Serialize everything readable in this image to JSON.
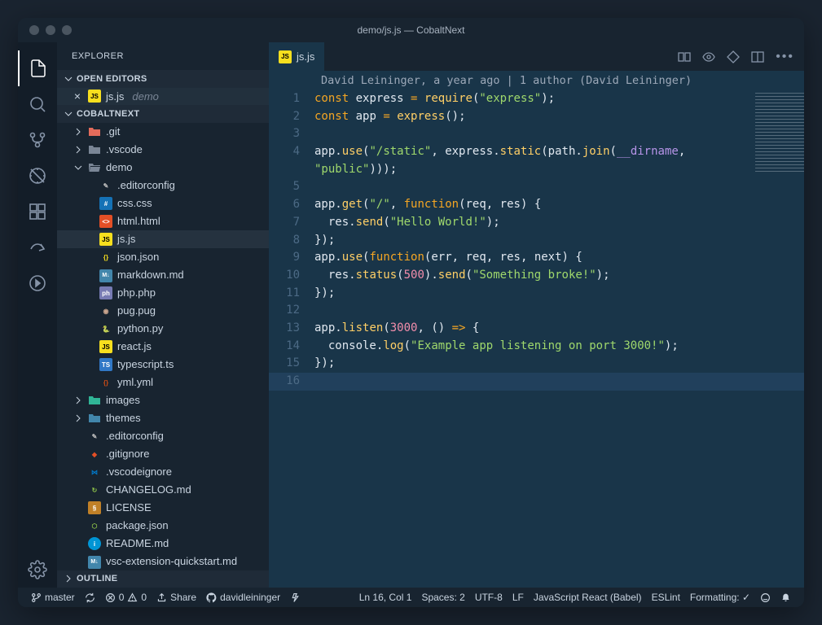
{
  "window": {
    "title": "demo/js.js — CobaltNext"
  },
  "sidebar": {
    "title": "EXPLORER",
    "sections": {
      "open_editors": {
        "label": "OPEN EDITORS",
        "items": [
          {
            "name": "js.js",
            "dir": "demo",
            "icon": "js"
          }
        ]
      },
      "workspace": {
        "label": "COBALTNEXT",
        "tree": [
          {
            "d": 0,
            "chev": "right",
            "icon": "folder-git",
            "name": ".git"
          },
          {
            "d": 0,
            "chev": "right",
            "icon": "folder",
            "name": ".vscode"
          },
          {
            "d": 0,
            "chev": "down",
            "icon": "folder-open",
            "name": "demo"
          },
          {
            "d": 1,
            "icon": "config",
            "name": ".editorconfig"
          },
          {
            "d": 1,
            "icon": "css",
            "name": "css.css"
          },
          {
            "d": 1,
            "icon": "html",
            "name": "html.html"
          },
          {
            "d": 1,
            "icon": "js",
            "name": "js.js",
            "active": true
          },
          {
            "d": 1,
            "icon": "json",
            "name": "json.json"
          },
          {
            "d": 1,
            "icon": "md",
            "name": "markdown.md"
          },
          {
            "d": 1,
            "icon": "php",
            "name": "php.php"
          },
          {
            "d": 1,
            "icon": "pug",
            "name": "pug.pug"
          },
          {
            "d": 1,
            "icon": "py",
            "name": "python.py"
          },
          {
            "d": 1,
            "icon": "js",
            "name": "react.js"
          },
          {
            "d": 1,
            "icon": "ts",
            "name": "typescript.ts"
          },
          {
            "d": 1,
            "icon": "yml",
            "name": "yml.yml"
          },
          {
            "d": 0,
            "chev": "right",
            "icon": "folder-img",
            "name": "images"
          },
          {
            "d": 0,
            "chev": "right",
            "icon": "folder-theme",
            "name": "themes"
          },
          {
            "d": 0,
            "icon": "config",
            "name": ".editorconfig"
          },
          {
            "d": 0,
            "icon": "git",
            "name": ".gitignore"
          },
          {
            "d": 0,
            "icon": "vs",
            "name": ".vscodeignore"
          },
          {
            "d": 0,
            "icon": "changelog",
            "name": "CHANGELOG.md"
          },
          {
            "d": 0,
            "icon": "license",
            "name": "LICENSE"
          },
          {
            "d": 0,
            "icon": "npm",
            "name": "package.json"
          },
          {
            "d": 0,
            "icon": "readme",
            "name": "README.md"
          },
          {
            "d": 0,
            "icon": "md",
            "name": "vsc-extension-quickstart.md"
          }
        ]
      },
      "outline": {
        "label": "OUTLINE"
      }
    }
  },
  "tabs": {
    "open": [
      {
        "name": "js.js",
        "icon": "js"
      }
    ]
  },
  "editor": {
    "blame": "David Leininger, a year ago | 1 author (David Leininger)",
    "code_lines": [
      {
        "n": 1,
        "html": "<span class='kw'>const</span> <span class='id'>express</span> <span class='op'>=</span> <span class='method'>require</span><span class='paren'>(</span><span class='str'>\"express\"</span><span class='paren'>)</span>;"
      },
      {
        "n": 2,
        "html": "<span class='kw'>const</span> <span class='id'>app</span> <span class='op'>=</span> <span class='method'>express</span><span class='paren'>()</span>;"
      },
      {
        "n": 3,
        "html": ""
      },
      {
        "n": 4,
        "html": "<span class='id'>app</span>.<span class='method'>use</span><span class='paren'>(</span><span class='str'>\"/static\"</span>, <span class='id'>express</span>.<span class='method'>static</span><span class='paren'>(</span><span class='id'>path</span>.<span class='method'>join</span><span class='paren'>(</span><span class='global'>__dirname</span>,"
      },
      {
        "n": "",
        "html": "<span class='str'>\"public\"</span><span class='paren'>)))</span>;"
      },
      {
        "n": 5,
        "html": ""
      },
      {
        "n": 6,
        "html": "<span class='id'>app</span>.<span class='method'>get</span><span class='paren'>(</span><span class='str'>\"/\"</span>, <span class='kw'>function</span><span class='paren'>(</span><span class='id'>req</span>, <span class='id'>res</span><span class='paren'>)</span> <span class='paren'>{</span>"
      },
      {
        "n": 7,
        "html": "  <span class='id'>res</span>.<span class='method'>send</span><span class='paren'>(</span><span class='str'>\"Hello World!\"</span><span class='paren'>)</span>;"
      },
      {
        "n": 8,
        "html": "<span class='paren'>})</span>;"
      },
      {
        "n": 9,
        "html": "<span class='id'>app</span>.<span class='method'>use</span><span class='paren'>(</span><span class='kw'>function</span><span class='paren'>(</span><span class='id'>err</span>, <span class='id'>req</span>, <span class='id'>res</span>, <span class='id'>next</span><span class='paren'>)</span> <span class='paren'>{</span>"
      },
      {
        "n": 10,
        "html": "  <span class='id'>res</span>.<span class='method'>status</span><span class='paren'>(</span><span class='num'>500</span><span class='paren'>)</span>.<span class='method'>send</span><span class='paren'>(</span><span class='str'>\"Something broke!\"</span><span class='paren'>)</span>;"
      },
      {
        "n": 11,
        "html": "<span class='paren'>})</span>;"
      },
      {
        "n": 12,
        "html": ""
      },
      {
        "n": 13,
        "html": "<span class='id'>app</span>.<span class='method'>listen</span><span class='paren'>(</span><span class='num'>3000</span>, <span class='paren'>()</span> <span class='arrow'>=></span> <span class='paren'>{</span>"
      },
      {
        "n": 14,
        "html": "  <span class='id'>console</span>.<span class='method'>log</span><span class='paren'>(</span><span class='str'>\"Example app listening on port 3000!\"</span><span class='paren'>)</span>;"
      },
      {
        "n": 15,
        "html": "<span class='paren'>})</span>;"
      },
      {
        "n": 16,
        "html": "",
        "current": true
      }
    ]
  },
  "statusbar": {
    "branch": "master",
    "errors": "0",
    "warnings": "0",
    "share": "Share",
    "github_user": "davidleininger",
    "position": "Ln 16, Col 1",
    "spaces": "Spaces: 2",
    "encoding": "UTF-8",
    "eol": "LF",
    "language": "JavaScript React (Babel)",
    "linter": "ESLint",
    "formatting": "Formatting: ✓"
  },
  "colors": {
    "bg": "#193549",
    "sidebar": "#182430",
    "accent": "#f5a623"
  }
}
